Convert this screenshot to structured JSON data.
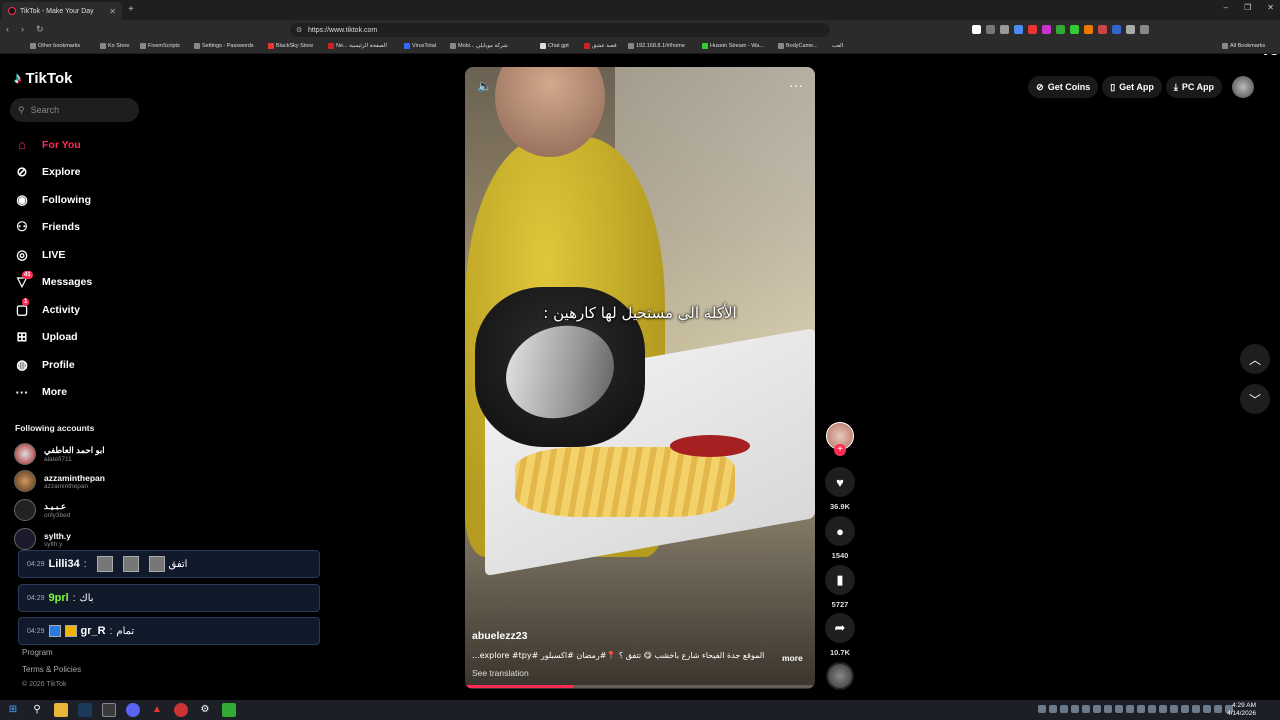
{
  "browser": {
    "tab_title": "TikTok - Make Your Day",
    "url": "https://www.tiktok.com",
    "new_tab": "+",
    "window_controls": [
      "–",
      "❐",
      "✕"
    ],
    "nav_buttons": [
      "‹",
      "›",
      "↻"
    ],
    "badge": "45",
    "bookmarks": [
      "Other bookmarks",
      "Ko Store",
      "FivemScripts",
      "Settings - Passwords",
      "BlackSky Store",
      "Ne... الصفحة الرئيسية",
      "VirusTotal",
      "Mobi... شركة موبايلي",
      "Chat gpt",
      "قصة عشق",
      "192.168.8.1/#/home",
      "Husein Stream - Wa...",
      "BodyCame...",
      "العب"
    ],
    "all_bookmarks": "All Bookmarks"
  },
  "sidebar": {
    "logo": "TikTok",
    "search_placeholder": "Search",
    "nav": [
      {
        "label": "For You",
        "icon": "home-icon",
        "glyph": "⌂",
        "active": true
      },
      {
        "label": "Explore",
        "icon": "compass-icon",
        "glyph": "⊘"
      },
      {
        "label": "Following",
        "icon": "following-avatar-icon",
        "glyph": "◉"
      },
      {
        "label": "Friends",
        "icon": "friends-icon",
        "glyph": "⚇"
      },
      {
        "label": "LIVE",
        "icon": "live-icon",
        "glyph": "◎"
      },
      {
        "label": "Messages",
        "icon": "messages-icon",
        "glyph": "▽",
        "count": "41"
      },
      {
        "label": "Activity",
        "icon": "activity-icon",
        "glyph": "▢",
        "count": "1"
      },
      {
        "label": "Upload",
        "icon": "upload-icon",
        "glyph": "⊞"
      },
      {
        "label": "Profile",
        "icon": "profile-icon",
        "glyph": "◍"
      },
      {
        "label": "More",
        "icon": "more-icon",
        "glyph": "···"
      }
    ],
    "following_header": "Following accounts",
    "accounts": [
      {
        "name": "ابو احمد العاطفي",
        "handle": "alatefi711"
      },
      {
        "name": "azzaminthepan",
        "handle": "azzaminthepan"
      },
      {
        "name": "عـبـيـد",
        "handle": "only3bed"
      },
      {
        "name": "sylth.y",
        "handle": "sylth.y"
      }
    ],
    "chat": [
      {
        "time": "04:29",
        "user": "Lilli34",
        "sep": ":",
        "msg": "اتفق",
        "color": "#ffffff"
      },
      {
        "time": "04:29",
        "user": "9prl",
        "sep": ":",
        "msg": "باك",
        "color": "#7CFC3A"
      },
      {
        "time": "04:29",
        "user": "gr_R",
        "sep": ":",
        "msg": "تمام",
        "color": "#ffffff"
      }
    ],
    "footer": [
      "Program",
      "Terms & Policies",
      "© 2026 TikTok"
    ]
  },
  "video": {
    "caption": "الأكلة الي مستحيل لها كارهين :",
    "author": "abuelezz23",
    "description": "الموقع جدة الفيحاء شارع باخشب 😋 تتفق ؟ 📍#رمضان #اكسبلور #explore #tpy...",
    "more": "more",
    "see_translation": "See translation",
    "progress": 0.31,
    "volume_icon": "🔈",
    "options_icon": "···"
  },
  "actions": {
    "plus": "+",
    "like_glyph": "♥",
    "likes": "36.9K",
    "comment_glyph": "●",
    "comments": "1540",
    "bookmark_glyph": "▮",
    "bookmarks": "5727",
    "share_glyph": "➦",
    "shares": "10.7K"
  },
  "topbar": {
    "get_coins": "Get Coins",
    "get_app": "Get App",
    "pc_app": "PC App"
  },
  "scroll": {
    "up": "︿",
    "down": "﹀"
  },
  "taskbar": {
    "time": "4:29 AM",
    "date": "4/14/2026"
  },
  "colors": {
    "accent": "#fe2c55",
    "cyan": "#25f4ee",
    "bg": "#000000"
  }
}
